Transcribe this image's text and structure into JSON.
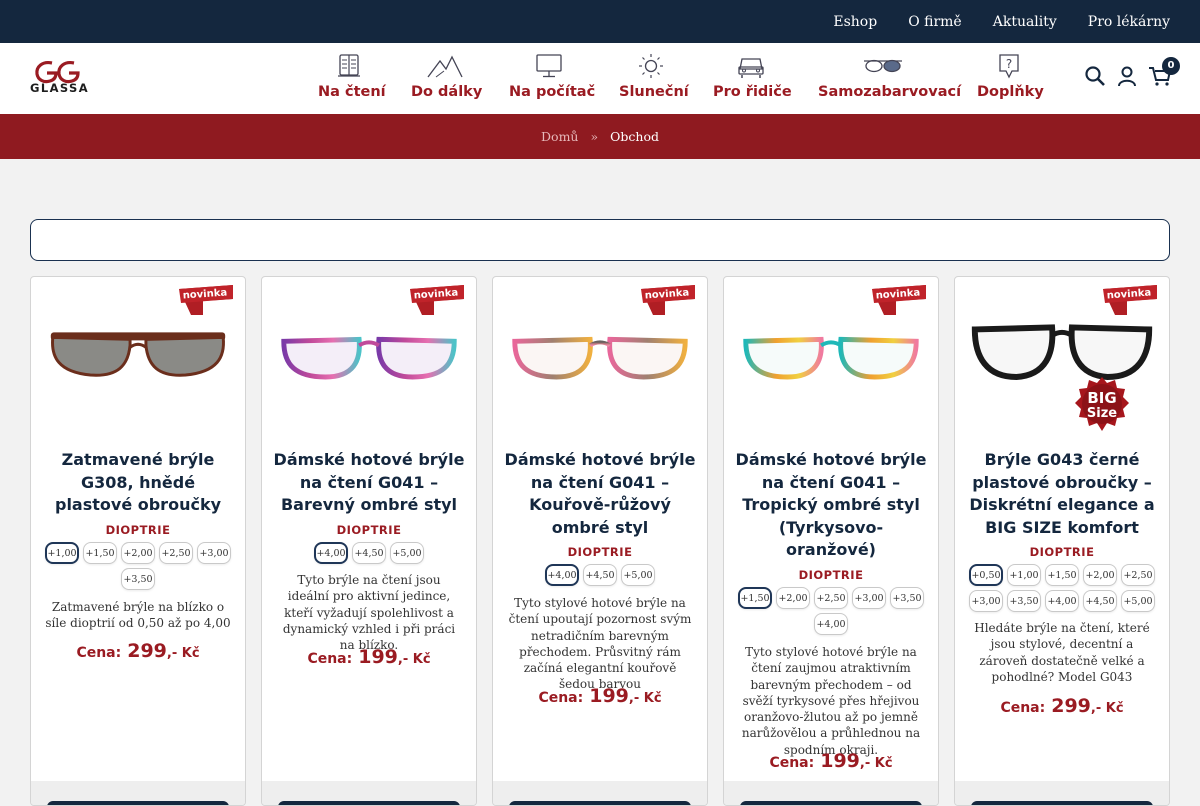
{
  "topnav": [
    "Eshop",
    "O firmě",
    "Aktuality",
    "Pro lékárny"
  ],
  "logo_text": "GLASSA",
  "nav": [
    {
      "label": "Na čtení",
      "icon": "book-icon"
    },
    {
      "label": "Do dálky",
      "icon": "mountain-icon"
    },
    {
      "label": "Na počítač",
      "icon": "monitor-icon"
    },
    {
      "label": "Sluneční",
      "icon": "sun-icon"
    },
    {
      "label": "Pro řidiče",
      "icon": "car-icon"
    },
    {
      "label": "Samozabarvovací",
      "icon": "sunglasses-icon"
    },
    {
      "label": "Doplňky",
      "icon": "question-bubble-icon"
    }
  ],
  "cart_count": "0",
  "breadcrumb": {
    "home": "Domů",
    "sep": "»",
    "current": "Obchod"
  },
  "badge_text": "novinka",
  "bigsize": {
    "line1": "BIG",
    "line2": "Size"
  },
  "price_label": "Cena:",
  "currency": ",- Kč",
  "products": [
    {
      "title": "Zatmavené brýle G308, hnědé plastové obroučky",
      "diop_label": "DIOPTRIE",
      "chips": [
        "+1,00",
        "+1,50",
        "+2,00",
        "+2,50",
        "+3,00",
        "+3,50"
      ],
      "desc": "Zatmavené brýle na blízko o síle dioptrií od 0,50 až po 4,00",
      "price": "299"
    },
    {
      "title": "Dámské hotové brýle na čtení G041 – Barevný ombré styl",
      "diop_label": "DIOPTRIE",
      "chips": [
        "+4,00",
        "+4,50",
        "+5,00"
      ],
      "desc": "Tyto brýle na čtení jsou ideální pro aktivní jedince, kteří vyžadují spolehlivost a dynamický vzhled i při práci na blízko.",
      "price": "199"
    },
    {
      "title": "Dámské hotové brýle na čtení G041 – Kouřově-růžový ombré styl",
      "diop_label": "DIOPTRIE",
      "chips": [
        "+4,00",
        "+4,50",
        "+5,00"
      ],
      "desc": "Tyto stylové hotové brýle na čtení upoutají pozornost svým netradičním barevným přechodem. Průsvitný rám začíná elegantní kouřově šedou barvou",
      "price": "199"
    },
    {
      "title": "Dámské hotové brýle na čtení G041 – Tropický ombré styl (Tyrkysovo-oranžové)",
      "diop_label": "DIOPTRIE",
      "chips": [
        "+1,50",
        "+2,00",
        "+2,50",
        "+3,00",
        "+3,50",
        "+4,00"
      ],
      "desc": "Tyto stylové hotové brýle na čtení zaujmou atraktivním barevným přechodem – od svěží tyrkysové přes hřejivou oranžovo-žlutou až po jemně narůžovělou a průhlednou na spodním okraji.",
      "price": "199"
    },
    {
      "title": "Brýle G043 černé plastové obroučky – Diskrétní elegance a BIG SIZE komfort",
      "diop_label": "DIOPTRIE",
      "chips": [
        "+0,50",
        "+1,00",
        "+1,50",
        "+2,00",
        "+2,50",
        "+3,00",
        "+3,50",
        "+4,00",
        "+4,50",
        "+5,00"
      ],
      "desc": "Hledáte brýle na čtení, které jsou stylové, decentní a zároveň dostatečně velké a pohodlné? Model G043",
      "price": "299"
    }
  ],
  "colors": {
    "navy": "#14273e",
    "maroon": "#8f1a20",
    "accent": "#9a1b22"
  }
}
